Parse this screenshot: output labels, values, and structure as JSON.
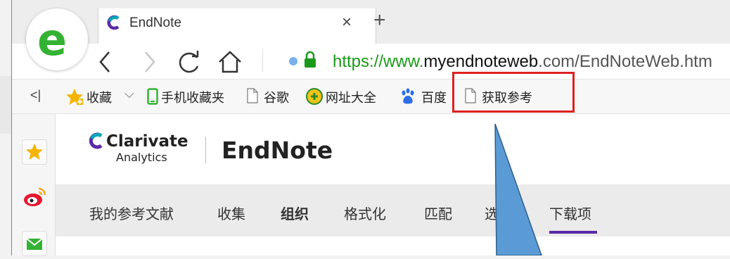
{
  "browser": {
    "tab_title": "EndNote",
    "tab_close": "×",
    "new_tab": "+",
    "url_scheme": "https://www.",
    "url_domain": "myendnoteweb",
    "url_rest": ".com/EndNoteWeb.htm"
  },
  "bookmarks": {
    "collapse": "<|",
    "favorites": "收藏",
    "favorites_caret": "⌵",
    "items": [
      "手机收藏夹",
      "谷歌",
      "网址大全",
      "百度",
      "获取参考"
    ]
  },
  "page": {
    "brand_line1": "Clarivate",
    "brand_line2": "Analytics",
    "product": "EndNote",
    "menu": [
      "我的参考文献",
      "收集",
      "组织",
      "格式化",
      "匹配",
      "选",
      "下载项"
    ],
    "active_menu": "下载项"
  },
  "colors": {
    "accent_green": "#34b233",
    "highlight_red": "#e02020",
    "menu_underline": "#5a2aa8",
    "arrow_fill": "#5b9bd5"
  }
}
